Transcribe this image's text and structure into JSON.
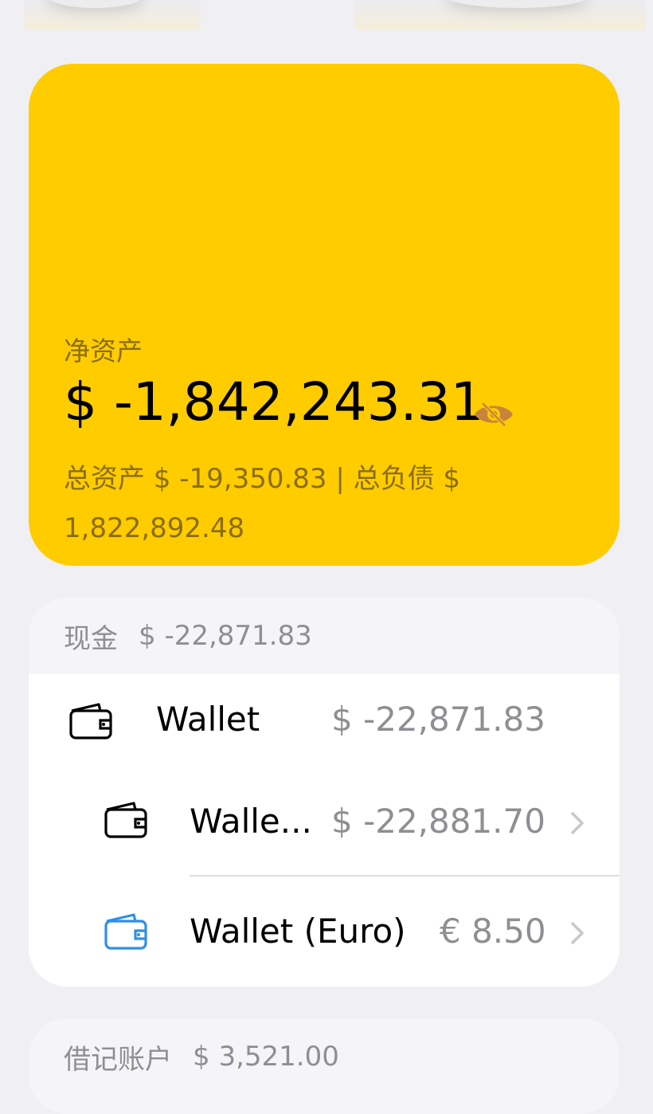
{
  "net_worth": {
    "label": "净资产",
    "amount": "$ -1,842,243.31",
    "summary": "总资产 $ -19,350.83 | 总负债 $ 1,822,892.48",
    "card_color": "#ffcc00",
    "eye_icon": "eye-slash-icon"
  },
  "cash": {
    "header_label": "现金",
    "header_amount": "$ -22,871.83",
    "rows": [
      {
        "name": "Wallet",
        "amount": "$ -22,871.83",
        "icon": "wallet-icon",
        "icon_color": "#000000"
      },
      {
        "name": "Walle...",
        "amount": "$ -22,881.70",
        "icon": "wallet-icon",
        "icon_color": "#000000"
      },
      {
        "name": "Wallet (Euro)",
        "amount": "€ 8.50",
        "icon": "wallet-icon",
        "icon_color": "#2f8fe8"
      }
    ]
  },
  "debit": {
    "header_label": "借记账户",
    "header_amount": "$ 3,521.00"
  }
}
